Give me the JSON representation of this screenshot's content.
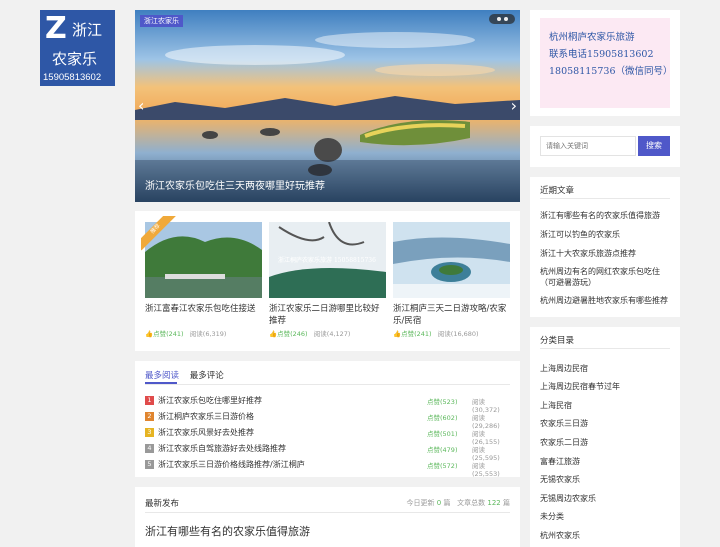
{
  "logo": {
    "letter": "Z",
    "line1": "浙江",
    "line2": "农家乐",
    "phone": "15905813602"
  },
  "slider": {
    "tag": "浙江农家乐",
    "caption": "浙江农家乐包吃住三天两夜哪里好玩推荐",
    "prev": "‹",
    "next": "›"
  },
  "thumbs": [
    {
      "ribbon": "推荐",
      "title": "浙江富春江农家乐包吃住接送",
      "likes": "点赞(241)",
      "reads": "阅读(6,319)"
    },
    {
      "title": "浙江农家乐二日游哪里比较好推荐",
      "likes": "点赞(246)",
      "reads": "阅读(4,127)",
      "overlay": "浙江桐庐农家乐旅游 15058815736"
    },
    {
      "title": "浙江桐庐三天二日游攻略/农家乐/民宿",
      "likes": "点赞(241)",
      "reads": "阅读(16,680)"
    }
  ],
  "reads": {
    "tabs": [
      "最多阅读",
      "最多评论"
    ],
    "rows": [
      {
        "num": "1",
        "title": "浙江农家乐包吃住哪里好推荐",
        "likes": "点赞(523)",
        "reads": "阅读(30,372)"
      },
      {
        "num": "2",
        "title": "浙江桐庐农家乐三日游价格",
        "likes": "点赞(602)",
        "reads": "阅读(29,286)"
      },
      {
        "num": "3",
        "title": "浙江农家乐风景好去处推荐",
        "likes": "点赞(501)",
        "reads": "阅读(26,155)"
      },
      {
        "num": "4",
        "title": "浙江农家乐自驾旅游好去处线路推荐",
        "likes": "点赞(479)",
        "reads": "阅读(25,595)"
      },
      {
        "num": "5",
        "title": "浙江农家乐三日游价格线路推荐/浙江桐庐",
        "likes": "点赞(572)",
        "reads": "阅读(25,553)"
      }
    ]
  },
  "latest": {
    "heading": "最新发布",
    "today_label": "今日更新",
    "today_count": "0",
    "today_unit": "篇",
    "total_label": "文章总数",
    "total_count": "122",
    "total_unit": "篇",
    "first": "浙江有哪些有名的农家乐值得旅游"
  },
  "contact": {
    "line1": "杭州桐庐农家乐旅游",
    "line2": "联系电话15905813602",
    "line3": "18058115736（微信同号）"
  },
  "search": {
    "placeholder": "请输入关键词",
    "button": "搜索"
  },
  "recent": {
    "heading": "近期文章",
    "items": [
      "浙江有哪些有名的农家乐值得旅游",
      "浙江可以钓鱼的农家乐",
      "浙江十大农家乐旅游点推荐",
      "杭州周边有名的网红农家乐包吃住（可避暑游玩）",
      "杭州周边避暑胜地农家乐有哪些推荐"
    ]
  },
  "cats": {
    "heading": "分类目录",
    "items": [
      "上海周边民宿",
      "上海周边民宿春节过年",
      "上海民宿",
      "农家乐三日游",
      "农家乐二日游",
      "富春江旅游",
      "无锡农家乐",
      "无锡周边农家乐",
      "未分类",
      "杭州农家乐"
    ]
  },
  "colors": {
    "accent": "#4f58c9",
    "logo_bg": "#2e57a6",
    "like": "#5cb85c",
    "rank": [
      "#e04b4b",
      "#e0852f",
      "#e6b422",
      "#999999",
      "#999999"
    ]
  },
  "icons": {
    "like": "thumb-up-icon"
  }
}
